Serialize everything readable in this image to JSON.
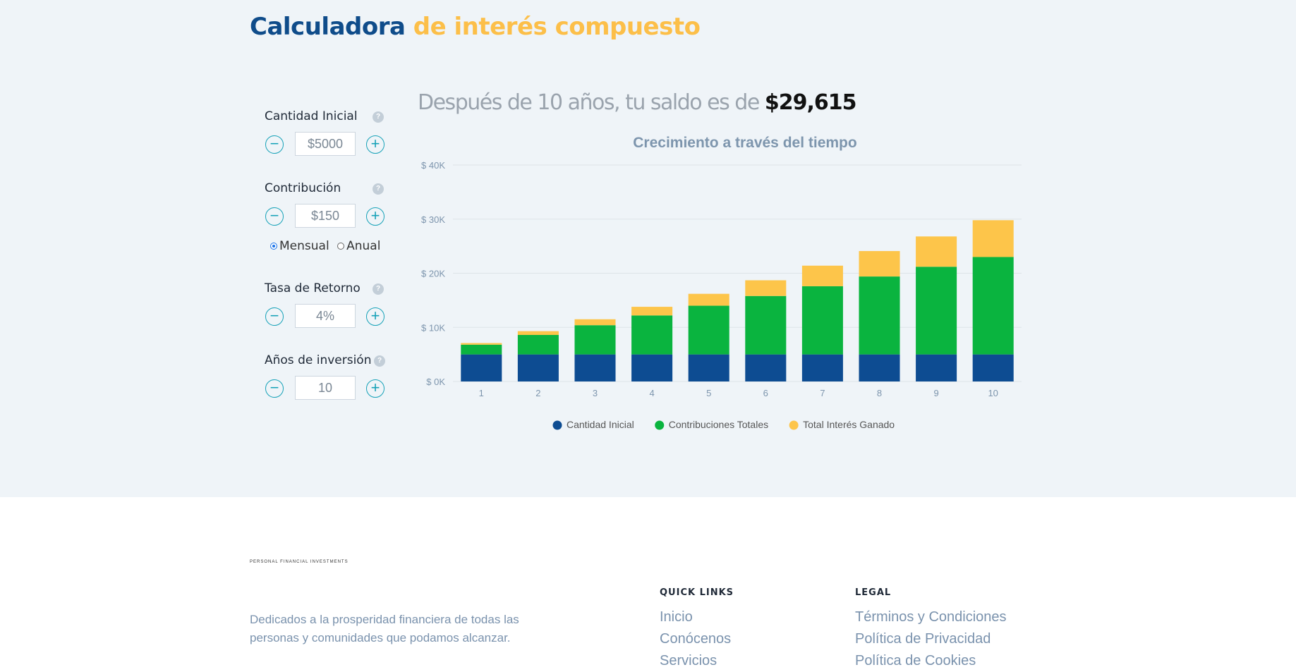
{
  "header": {
    "title_part1": "Calculadora",
    "title_part2": "de interés compuesto"
  },
  "inputs": {
    "initial_amount": {
      "label": "Cantidad Inicial",
      "value": "$5000"
    },
    "contribution": {
      "label": "Contribución",
      "value": "$150"
    },
    "frequency": {
      "options": [
        "Mensual",
        "Anual"
      ],
      "selected": "Mensual"
    },
    "return_rate": {
      "label": "Tasa de Retorno",
      "value": "4%"
    },
    "years": {
      "label": "Años de inversión",
      "value": "10"
    },
    "help_glyph": "?",
    "minus_glyph": "−",
    "plus_glyph": "+"
  },
  "result": {
    "prefix": "Después de 10 años, tu saldo es de",
    "amount": "$29,615"
  },
  "chart_data": {
    "type": "bar",
    "stacked": true,
    "title": "Crecimiento a través del tiempo",
    "categories": [
      "1",
      "2",
      "3",
      "4",
      "5",
      "6",
      "7",
      "8",
      "9",
      "10"
    ],
    "y_ticks": [
      "$ 0K",
      "$ 10K",
      "$ 20K",
      "$ 30K",
      "$ 40K"
    ],
    "ylim": [
      0,
      40000
    ],
    "series": [
      {
        "name": "Cantidad Inicial",
        "color": "#0d4c92",
        "values": [
          5000,
          5000,
          5000,
          5000,
          5000,
          5000,
          5000,
          5000,
          5000,
          5000
        ]
      },
      {
        "name": "Contribuciones Totales",
        "color": "#0ab43f",
        "values": [
          1800,
          3600,
          5400,
          7200,
          9000,
          10800,
          12600,
          14400,
          16200,
          18000
        ]
      },
      {
        "name": "Total Interés Ganado",
        "color": "#fdc54a",
        "values": [
          300,
          700,
          1100,
          1600,
          2200,
          2900,
          3800,
          4700,
          5600,
          6800
        ]
      }
    ],
    "grid": true,
    "legend": "bottom"
  },
  "footer": {
    "brand_tagline": "PERSONAL FINANCIAL INVESTMENTS",
    "description": "Dedicados a la prosperidad financiera de todas las personas y comunidades que podamos alcanzar.",
    "quick_links": {
      "title": "QUICK LINKS",
      "items": [
        "Inicio",
        "Conócenos",
        "Servicios"
      ]
    },
    "legal": {
      "title": "LEGAL",
      "items": [
        "Términos y Condiciones",
        "Política de Privacidad",
        "Política de Cookies"
      ]
    }
  }
}
